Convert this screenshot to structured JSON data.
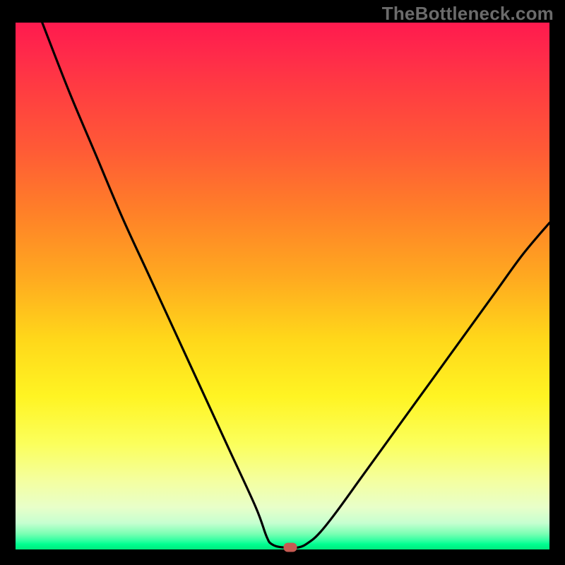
{
  "watermark": "TheBottleneck.com",
  "colors": {
    "frame": "#000000",
    "curve_stroke": "#000000",
    "marker": "#c65a52"
  },
  "chart_data": {
    "type": "line",
    "title": "",
    "xlabel": "",
    "ylabel": "",
    "xlim": [
      0,
      100
    ],
    "ylim": [
      0,
      100
    ],
    "series": [
      {
        "name": "curve",
        "x": [
          5,
          10,
          15,
          20,
          25,
          30,
          35,
          40,
          45,
          47,
          48,
          50,
          53,
          55,
          57,
          60,
          65,
          70,
          75,
          80,
          85,
          90,
          95,
          100
        ],
        "y": [
          100,
          87,
          75,
          63,
          52,
          41,
          30,
          19,
          8,
          2.5,
          1,
          0.4,
          0.4,
          1.4,
          3.2,
          7,
          14,
          21,
          28,
          35,
          42,
          49,
          56,
          62
        ]
      }
    ],
    "marker": {
      "x": 51.5,
      "y": 0.4
    },
    "description": "V-shaped bottleneck curve descending steeply from the top left, bottoming out near x≈50 at the very bottom, then rising toward the upper right with a gentler slope. A small rounded red marker sits at the dip."
  }
}
